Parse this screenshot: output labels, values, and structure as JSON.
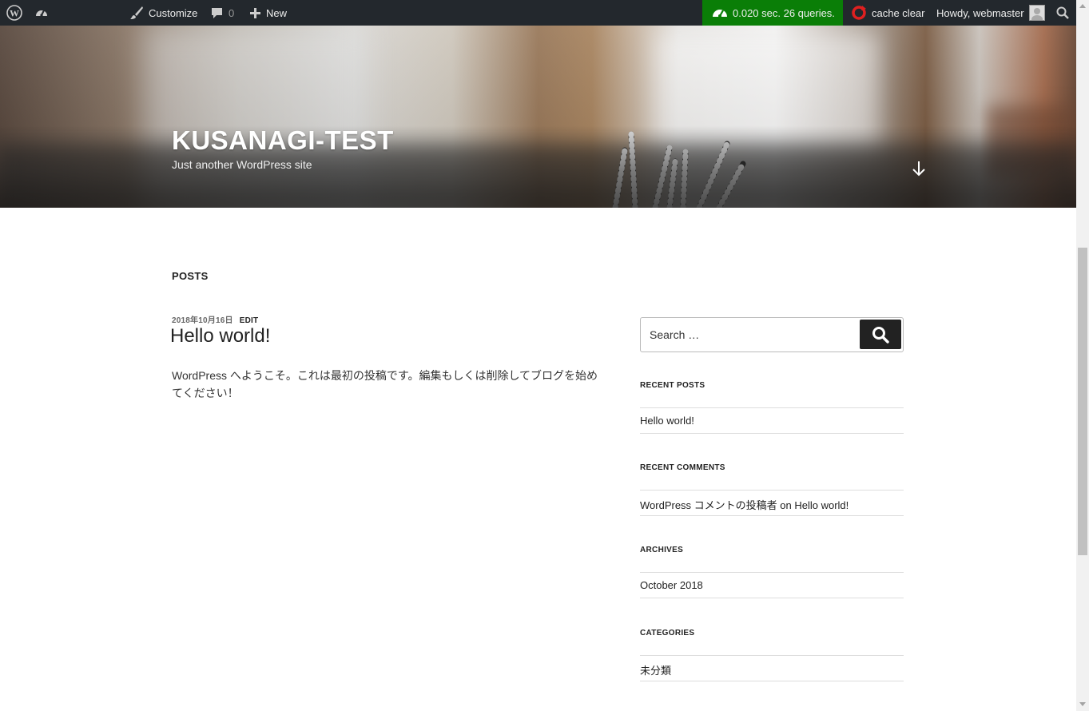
{
  "admin_bar": {
    "customize_label": "Customize",
    "comments_count": "0",
    "new_label": "New",
    "perf_text": "0.020 sec. 26 queries.",
    "cache_clear_label": "cache clear",
    "howdy_text": "Howdy, webmaster"
  },
  "header": {
    "site_title": "KUSANAGI-TEST",
    "site_description": "Just another WordPress site"
  },
  "main": {
    "posts_heading": "POSTS",
    "post": {
      "date": "2018年10月16日",
      "edit_label": "EDIT",
      "title": "Hello world!",
      "excerpt": "WordPress へようこそ。これは最初の投稿です。編集もしくは削除してブログを始めてください！"
    }
  },
  "sidebar": {
    "search_placeholder": "Search …",
    "recent_posts": {
      "title": "RECENT POSTS",
      "items": [
        "Hello world!"
      ]
    },
    "recent_comments": {
      "title": "RECENT COMMENTS",
      "items": [
        "WordPress コメントの投稿者 on Hello world!"
      ]
    },
    "archives": {
      "title": "ARCHIVES",
      "items": [
        "October 2018"
      ]
    },
    "categories": {
      "title": "CATEGORIES",
      "items": [
        "未分類"
      ]
    }
  },
  "colors": {
    "admin_bar_bg": "#23282d",
    "perf_badge_bg": "#0a7e07",
    "search_button_bg": "#222222"
  }
}
